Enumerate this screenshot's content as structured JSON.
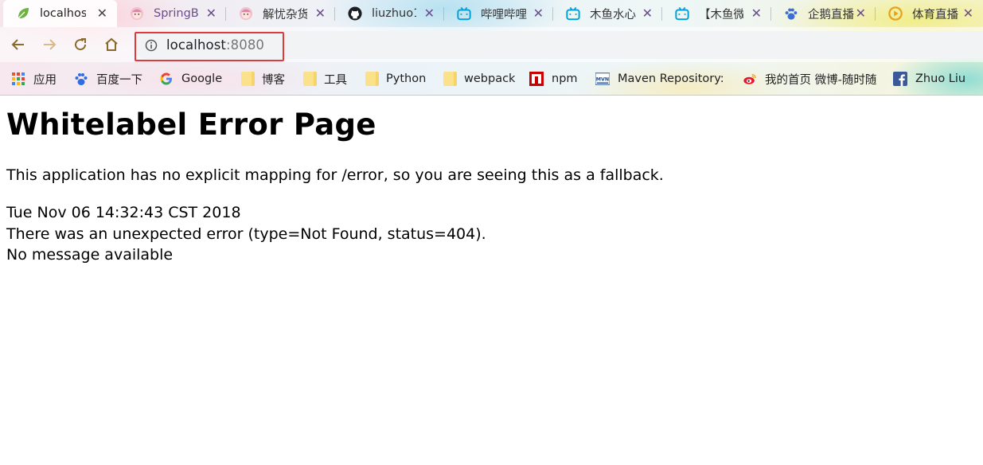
{
  "browser": {
    "tabs": [
      {
        "title": "localhos",
        "icon": "spring-leaf-icon",
        "active": true
      },
      {
        "title": "SpringB",
        "icon": "anime-avatar-icon",
        "active": false
      },
      {
        "title": "解忧杂货",
        "icon": "anime-avatar-icon",
        "active": false
      },
      {
        "title": "liuzhuo1",
        "icon": "github-icon",
        "active": false
      },
      {
        "title": "哔哩哔哩",
        "icon": "bilibili-icon",
        "active": false
      },
      {
        "title": "木鱼水心",
        "icon": "bilibili-icon",
        "active": false
      },
      {
        "title": "【木鱼微",
        "icon": "bilibili-icon",
        "active": false
      },
      {
        "title": "企鹅直播",
        "icon": "paw-icon",
        "active": false
      },
      {
        "title": "体育直播",
        "icon": "play-circle-icon",
        "active": false
      }
    ],
    "address": {
      "host": "localhost",
      "port": ":8080"
    },
    "bookmarks": [
      {
        "label": "应用",
        "icon": "apps-grid-icon"
      },
      {
        "label": "百度一下",
        "icon": "baidu-paw-icon"
      },
      {
        "label": "Google",
        "icon": "google-icon"
      },
      {
        "label": "博客",
        "icon": "folder-icon"
      },
      {
        "label": "工具",
        "icon": "folder-icon"
      },
      {
        "label": "Python",
        "icon": "folder-icon"
      },
      {
        "label": "webpack",
        "icon": "folder-icon"
      },
      {
        "label": "npm",
        "icon": "npm-icon"
      },
      {
        "label": "Maven Repository: :",
        "icon": "mvn-icon"
      },
      {
        "label": "我的首页 微博-随时随",
        "icon": "weibo-icon"
      },
      {
        "label": "Zhuo Liu",
        "icon": "facebook-icon"
      }
    ],
    "highlight_color": "#e03a3a"
  },
  "page": {
    "title": "Whitelabel Error Page",
    "message": "This application has no explicit mapping for /error, so you are seeing this as a fallback.",
    "timestamp": "Tue Nov 06 14:32:43 CST 2018",
    "error_line": "There was an unexpected error (type=Not Found, status=404).",
    "detail": "No message available"
  }
}
